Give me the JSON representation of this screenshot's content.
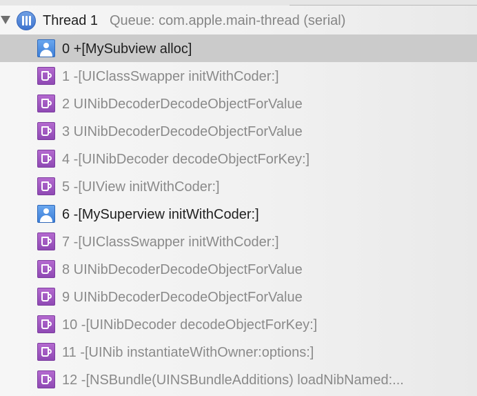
{
  "thread": {
    "title": "Thread 1",
    "queue": "Queue: com.apple.main-thread (serial)",
    "expanded": true,
    "icon": "thread-icon"
  },
  "frames": [
    {
      "label": "0 +[MySubview alloc]",
      "kind": "user",
      "icon": "user-code-icon",
      "selected": true
    },
    {
      "label": "1 -[UIClassSwapper initWithCoder:]",
      "kind": "system",
      "icon": "system-library-icon",
      "selected": false
    },
    {
      "label": "2 UINibDecoderDecodeObjectForValue",
      "kind": "system",
      "icon": "system-library-icon",
      "selected": false
    },
    {
      "label": "3 UINibDecoderDecodeObjectForValue",
      "kind": "system",
      "icon": "system-library-icon",
      "selected": false
    },
    {
      "label": "4 -[UINibDecoder decodeObjectForKey:]",
      "kind": "system",
      "icon": "system-library-icon",
      "selected": false
    },
    {
      "label": "5 -[UIView initWithCoder:]",
      "kind": "system",
      "icon": "system-library-icon",
      "selected": false
    },
    {
      "label": "6 -[MySuperview initWithCoder:]",
      "kind": "user",
      "icon": "user-code-icon",
      "selected": false
    },
    {
      "label": "7 -[UIClassSwapper initWithCoder:]",
      "kind": "system",
      "icon": "system-library-icon",
      "selected": false
    },
    {
      "label": "8 UINibDecoderDecodeObjectForValue",
      "kind": "system",
      "icon": "system-library-icon",
      "selected": false
    },
    {
      "label": "9 UINibDecoderDecodeObjectForValue",
      "kind": "system",
      "icon": "system-library-icon",
      "selected": false
    },
    {
      "label": "10 -[UINibDecoder decodeObjectForKey:]",
      "kind": "system",
      "icon": "system-library-icon",
      "selected": false
    },
    {
      "label": "11 -[UINib instantiateWithOwner:options:]",
      "kind": "system",
      "icon": "system-library-icon",
      "selected": false
    },
    {
      "label": "12 -[NSBundle(UINSBundleAdditions) loadNibNamed:...",
      "kind": "system",
      "icon": "system-library-icon",
      "selected": false
    }
  ],
  "colors": {
    "selected_row": "#cbcbcb",
    "user_frame_text": "#1f1f1f",
    "system_frame_text": "#8a8a8a",
    "user_icon": "#3d7fd8",
    "system_icon": "#9a52be",
    "queue_text": "#858585"
  }
}
